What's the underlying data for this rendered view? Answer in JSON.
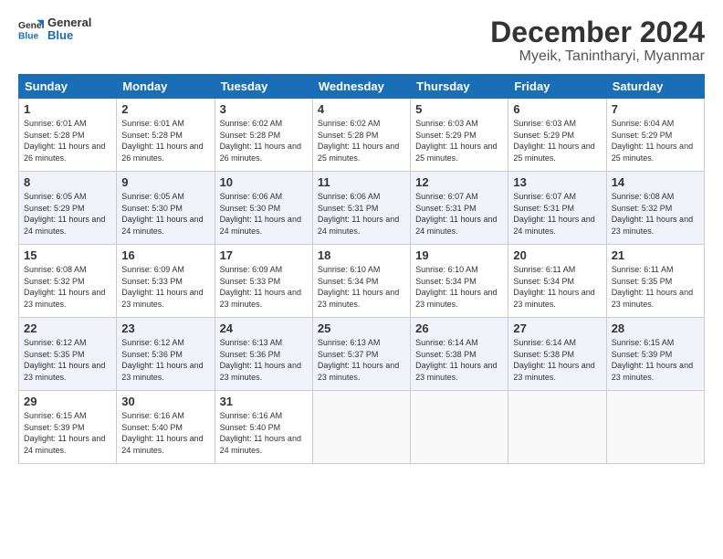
{
  "header": {
    "logo_general": "General",
    "logo_blue": "Blue",
    "month_title": "December 2024",
    "location": "Myeik, Tanintharyi, Myanmar"
  },
  "weekdays": [
    "Sunday",
    "Monday",
    "Tuesday",
    "Wednesday",
    "Thursday",
    "Friday",
    "Saturday"
  ],
  "weeks": [
    [
      {
        "day": "1",
        "sunrise": "6:01 AM",
        "sunset": "5:28 PM",
        "daylight": "11 hours and 26 minutes."
      },
      {
        "day": "2",
        "sunrise": "6:01 AM",
        "sunset": "5:28 PM",
        "daylight": "11 hours and 26 minutes."
      },
      {
        "day": "3",
        "sunrise": "6:02 AM",
        "sunset": "5:28 PM",
        "daylight": "11 hours and 26 minutes."
      },
      {
        "day": "4",
        "sunrise": "6:02 AM",
        "sunset": "5:28 PM",
        "daylight": "11 hours and 25 minutes."
      },
      {
        "day": "5",
        "sunrise": "6:03 AM",
        "sunset": "5:29 PM",
        "daylight": "11 hours and 25 minutes."
      },
      {
        "day": "6",
        "sunrise": "6:03 AM",
        "sunset": "5:29 PM",
        "daylight": "11 hours and 25 minutes."
      },
      {
        "day": "7",
        "sunrise": "6:04 AM",
        "sunset": "5:29 PM",
        "daylight": "11 hours and 25 minutes."
      }
    ],
    [
      {
        "day": "8",
        "sunrise": "6:05 AM",
        "sunset": "5:29 PM",
        "daylight": "11 hours and 24 minutes."
      },
      {
        "day": "9",
        "sunrise": "6:05 AM",
        "sunset": "5:30 PM",
        "daylight": "11 hours and 24 minutes."
      },
      {
        "day": "10",
        "sunrise": "6:06 AM",
        "sunset": "5:30 PM",
        "daylight": "11 hours and 24 minutes."
      },
      {
        "day": "11",
        "sunrise": "6:06 AM",
        "sunset": "5:31 PM",
        "daylight": "11 hours and 24 minutes."
      },
      {
        "day": "12",
        "sunrise": "6:07 AM",
        "sunset": "5:31 PM",
        "daylight": "11 hours and 24 minutes."
      },
      {
        "day": "13",
        "sunrise": "6:07 AM",
        "sunset": "5:31 PM",
        "daylight": "11 hours and 24 minutes."
      },
      {
        "day": "14",
        "sunrise": "6:08 AM",
        "sunset": "5:32 PM",
        "daylight": "11 hours and 23 minutes."
      }
    ],
    [
      {
        "day": "15",
        "sunrise": "6:08 AM",
        "sunset": "5:32 PM",
        "daylight": "11 hours and 23 minutes."
      },
      {
        "day": "16",
        "sunrise": "6:09 AM",
        "sunset": "5:33 PM",
        "daylight": "11 hours and 23 minutes."
      },
      {
        "day": "17",
        "sunrise": "6:09 AM",
        "sunset": "5:33 PM",
        "daylight": "11 hours and 23 minutes."
      },
      {
        "day": "18",
        "sunrise": "6:10 AM",
        "sunset": "5:34 PM",
        "daylight": "11 hours and 23 minutes."
      },
      {
        "day": "19",
        "sunrise": "6:10 AM",
        "sunset": "5:34 PM",
        "daylight": "11 hours and 23 minutes."
      },
      {
        "day": "20",
        "sunrise": "6:11 AM",
        "sunset": "5:34 PM",
        "daylight": "11 hours and 23 minutes."
      },
      {
        "day": "21",
        "sunrise": "6:11 AM",
        "sunset": "5:35 PM",
        "daylight": "11 hours and 23 minutes."
      }
    ],
    [
      {
        "day": "22",
        "sunrise": "6:12 AM",
        "sunset": "5:35 PM",
        "daylight": "11 hours and 23 minutes."
      },
      {
        "day": "23",
        "sunrise": "6:12 AM",
        "sunset": "5:36 PM",
        "daylight": "11 hours and 23 minutes."
      },
      {
        "day": "24",
        "sunrise": "6:13 AM",
        "sunset": "5:36 PM",
        "daylight": "11 hours and 23 minutes."
      },
      {
        "day": "25",
        "sunrise": "6:13 AM",
        "sunset": "5:37 PM",
        "daylight": "11 hours and 23 minutes."
      },
      {
        "day": "26",
        "sunrise": "6:14 AM",
        "sunset": "5:38 PM",
        "daylight": "11 hours and 23 minutes."
      },
      {
        "day": "27",
        "sunrise": "6:14 AM",
        "sunset": "5:38 PM",
        "daylight": "11 hours and 23 minutes."
      },
      {
        "day": "28",
        "sunrise": "6:15 AM",
        "sunset": "5:39 PM",
        "daylight": "11 hours and 23 minutes."
      }
    ],
    [
      {
        "day": "29",
        "sunrise": "6:15 AM",
        "sunset": "5:39 PM",
        "daylight": "11 hours and 24 minutes."
      },
      {
        "day": "30",
        "sunrise": "6:16 AM",
        "sunset": "5:40 PM",
        "daylight": "11 hours and 24 minutes."
      },
      {
        "day": "31",
        "sunrise": "6:16 AM",
        "sunset": "5:40 PM",
        "daylight": "11 hours and 24 minutes."
      },
      null,
      null,
      null,
      null
    ]
  ]
}
